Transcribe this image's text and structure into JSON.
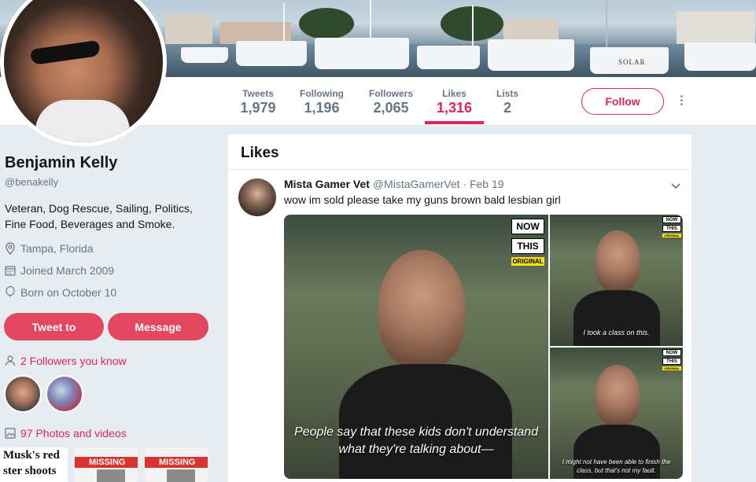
{
  "profile": {
    "name": "Benjamin Kelly",
    "handle": "@benakelly",
    "bio": "Veteran, Dog Rescue, Sailing, Politics, Fine Food, Beverages and Smoke.",
    "location": "Tampa, Florida",
    "joined": "Joined March 2009",
    "born": "Born on October 10",
    "tweet_to_label": "Tweet to",
    "message_label": "Message",
    "followers_you_know": "2 Followers you know",
    "photos_videos": "97 Photos and videos",
    "thumb_headline": "Musk's red ster shoots",
    "missing_label": "MISSING"
  },
  "banner": {
    "boat_name": "SOLAR"
  },
  "nav": {
    "stats": [
      {
        "label": "Tweets",
        "value": "1,979"
      },
      {
        "label": "Following",
        "value": "1,196"
      },
      {
        "label": "Followers",
        "value": "2,065"
      },
      {
        "label": "Likes",
        "value": "1,316",
        "active": true
      },
      {
        "label": "Lists",
        "value": "2"
      }
    ],
    "follow_label": "Follow"
  },
  "timeline": {
    "title": "Likes",
    "tweet": {
      "author_name": "Mista Gamer Vet",
      "author_handle": "@MistaGamerVet",
      "date": "· Feb 19",
      "text": "wow im sold please take my guns brown bald lesbian girl",
      "media": {
        "logo_line1": "NOW",
        "logo_line2": "THIS",
        "logo_line3": "ORIGINAL",
        "caption_main": "People say that these kids don't understand what they're talking about—",
        "caption_top_right": "I took a class on this.",
        "caption_bottom_right": "I might not have been able to finish the class, but that's not my fault."
      }
    }
  },
  "colors": {
    "accent": "#e0245e",
    "button_fill": "#e2475f",
    "muted": "#657786",
    "background": "#e6ecf0"
  }
}
